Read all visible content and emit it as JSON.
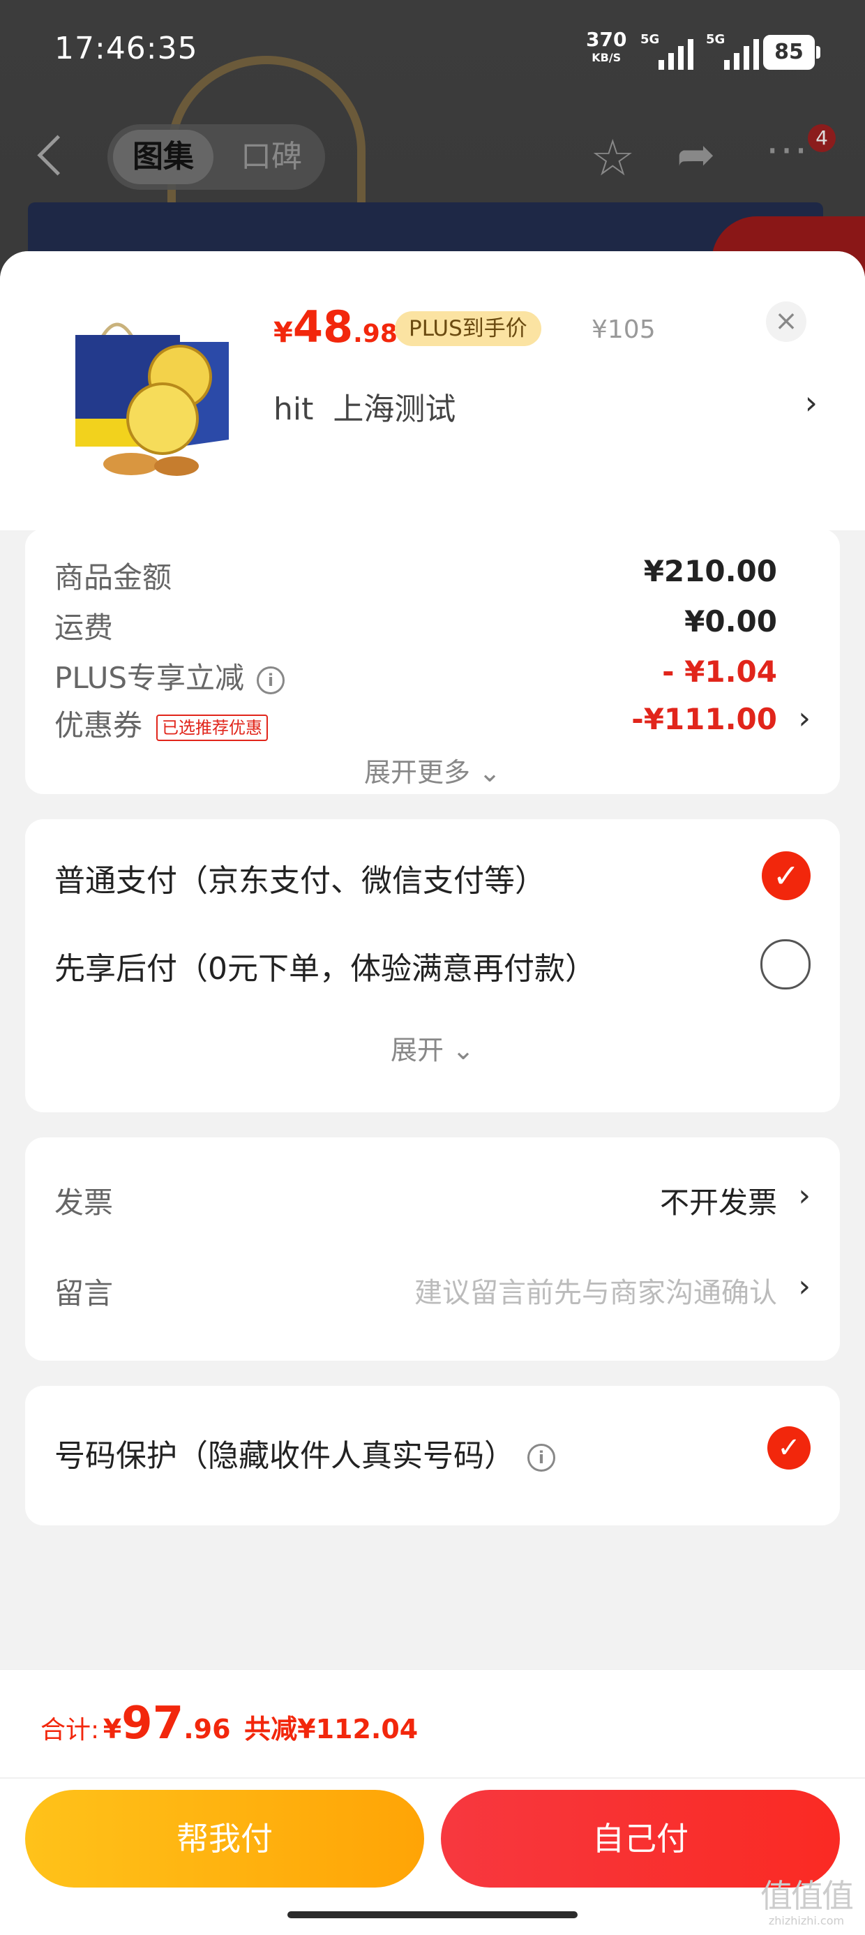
{
  "status_bar": {
    "time": "17:46:35",
    "net_speed_value": "370",
    "net_speed_unit": "KB/S",
    "signal1_label": "5G",
    "signal2_label": "5G",
    "battery": "85"
  },
  "top_nav": {
    "tabs": [
      {
        "label": "图集",
        "active": true
      },
      {
        "label": "口碑",
        "active": false
      }
    ],
    "more_badge": "4",
    "icons": [
      "back-icon",
      "star-icon",
      "share-icon",
      "more-icon"
    ]
  },
  "summary": {
    "price_currency": "¥",
    "price_int": "48",
    "price_dec": ".98",
    "plus_badge": "PLUS到手价",
    "original_price": "¥105",
    "address": "hit  上海测试",
    "close_icon": "×"
  },
  "amounts": {
    "rows": [
      {
        "label": "商品金额",
        "value": "¥210.00"
      },
      {
        "label": "运费",
        "value": "¥0.00"
      },
      {
        "label": "PLUS专享立减",
        "value": "- ¥1.04"
      },
      {
        "label": "优惠券",
        "tag": "已选推荐优惠",
        "value": "-¥111.00"
      }
    ],
    "expand_label": "展开更多",
    "accent_color": "#e1251b"
  },
  "payment": {
    "options": [
      {
        "label": "普通支付（京东支付、微信支付等）",
        "selected": true
      },
      {
        "label": "先享后付（0元下单，体验满意再付款）",
        "selected": false
      }
    ],
    "expand_label": "展开"
  },
  "extras": {
    "invoice_label": "发票",
    "invoice_value": "不开发票",
    "message_label": "留言",
    "message_placeholder": "建议留言前先与商家沟通确认"
  },
  "privacy": {
    "label": "号码保护（隐藏收件人真实号码）",
    "checked": true
  },
  "bottom_bar": {
    "total_label": "合计:",
    "total_currency": "¥",
    "total_int": "97",
    "total_dec": ".96",
    "savings": "共减¥112.04",
    "btn_help": "帮我付",
    "btn_self": "自己付"
  },
  "watermark": {
    "text": "值值值",
    "domain": "zhizhizhi.com"
  }
}
